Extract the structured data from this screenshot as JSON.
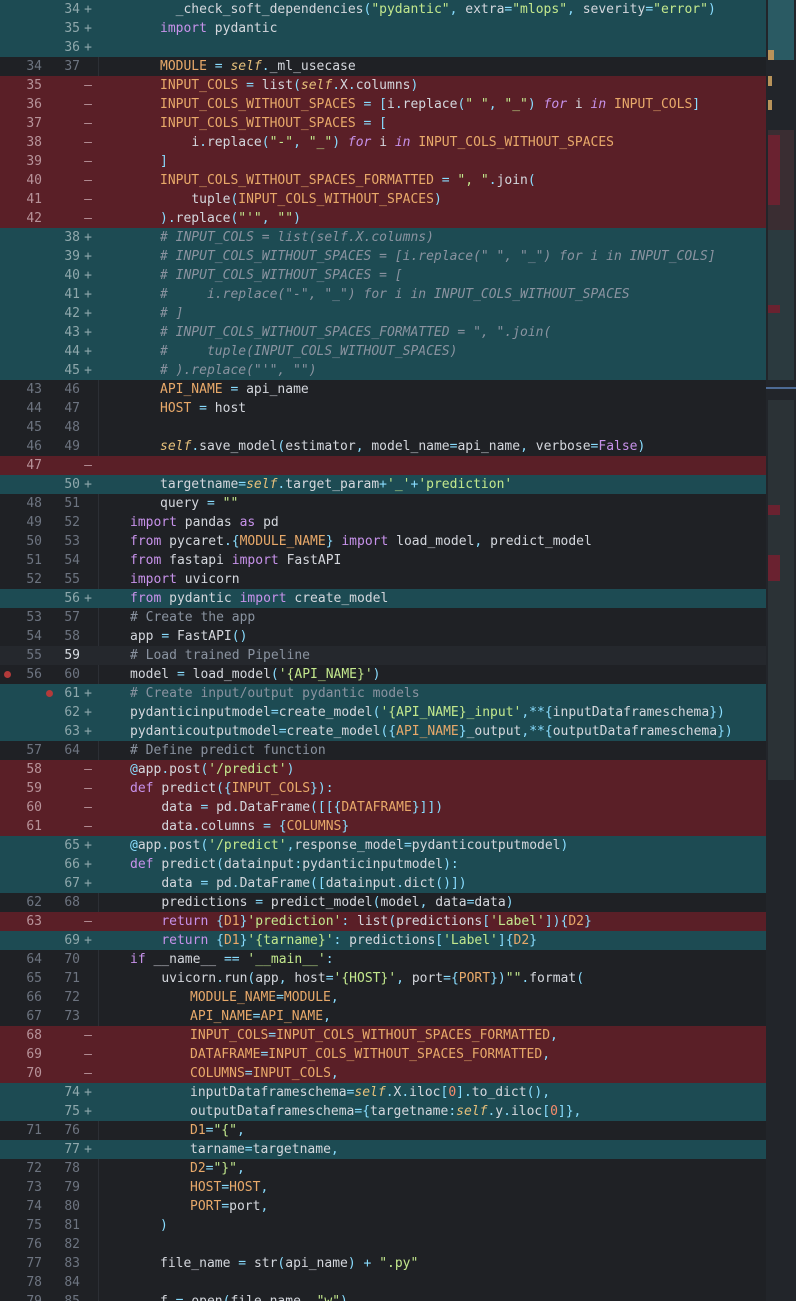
{
  "colors": {
    "added_bg": "#1d4b53",
    "removed_bg": "#5a1f27",
    "editor_bg": "#1f2125"
  },
  "lines": [
    {
      "old": "",
      "new": "34",
      "mark": "+",
      "type": "added",
      "code": "  _check_soft_dependencies(\"pydantic\", extra=\"mlops\", severity=\"error\")",
      "indent": 160
    },
    {
      "old": "",
      "new": "35",
      "mark": "+",
      "type": "added",
      "code": "import pydantic",
      "indent": 160
    },
    {
      "old": "",
      "new": "36",
      "mark": "+",
      "type": "added",
      "code": "",
      "indent": 160
    },
    {
      "old": "34",
      "new": "37",
      "mark": "",
      "type": "normal",
      "code": "MODULE = self._ml_usecase",
      "indent": 160
    },
    {
      "old": "35",
      "new": "",
      "mark": "—",
      "type": "removed",
      "code": "INPUT_COLS = list(self.X.columns)",
      "indent": 160
    },
    {
      "old": "36",
      "new": "",
      "mark": "—",
      "type": "removed",
      "code": "INPUT_COLS_WITHOUT_SPACES = [i.replace(\" \", \"_\") for i in INPUT_COLS]",
      "indent": 160
    },
    {
      "old": "37",
      "new": "",
      "mark": "—",
      "type": "removed",
      "code": "INPUT_COLS_WITHOUT_SPACES = [",
      "indent": 160
    },
    {
      "old": "38",
      "new": "",
      "mark": "—",
      "type": "removed",
      "code": "    i.replace(\"-\", \"_\") for i in INPUT_COLS_WITHOUT_SPACES",
      "indent": 160
    },
    {
      "old": "39",
      "new": "",
      "mark": "—",
      "type": "removed",
      "code": "]",
      "indent": 160
    },
    {
      "old": "40",
      "new": "",
      "mark": "—",
      "type": "removed",
      "code": "INPUT_COLS_WITHOUT_SPACES_FORMATTED = \", \".join(",
      "indent": 160
    },
    {
      "old": "41",
      "new": "",
      "mark": "—",
      "type": "removed",
      "code": "    tuple(INPUT_COLS_WITHOUT_SPACES)",
      "indent": 160
    },
    {
      "old": "42",
      "new": "",
      "mark": "—",
      "type": "removed",
      "code": ").replace(\"'\", \"\")",
      "indent": 160
    },
    {
      "old": "",
      "new": "38",
      "mark": "+",
      "type": "added",
      "code": "# INPUT_COLS = list(self.X.columns)",
      "indent": 160,
      "comment": true
    },
    {
      "old": "",
      "new": "39",
      "mark": "+",
      "type": "added",
      "code": "# INPUT_COLS_WITHOUT_SPACES = [i.replace(\" \", \"_\") for i in INPUT_COLS]",
      "indent": 160,
      "comment": true
    },
    {
      "old": "",
      "new": "40",
      "mark": "+",
      "type": "added",
      "code": "# INPUT_COLS_WITHOUT_SPACES = [",
      "indent": 160,
      "comment": true
    },
    {
      "old": "",
      "new": "41",
      "mark": "+",
      "type": "added",
      "code": "#     i.replace(\"-\", \"_\") for i in INPUT_COLS_WITHOUT_SPACES",
      "indent": 160,
      "comment": true
    },
    {
      "old": "",
      "new": "42",
      "mark": "+",
      "type": "added",
      "code": "# ]",
      "indent": 160,
      "comment": true
    },
    {
      "old": "",
      "new": "43",
      "mark": "+",
      "type": "added",
      "code": "# INPUT_COLS_WITHOUT_SPACES_FORMATTED = \", \".join(",
      "indent": 160,
      "comment": true
    },
    {
      "old": "",
      "new": "44",
      "mark": "+",
      "type": "added",
      "code": "#     tuple(INPUT_COLS_WITHOUT_SPACES)",
      "indent": 160,
      "comment": true
    },
    {
      "old": "",
      "new": "45",
      "mark": "+",
      "type": "added",
      "code": "# ).replace(\"'\", \"\")",
      "indent": 160,
      "comment": true
    },
    {
      "old": "43",
      "new": "46",
      "mark": "",
      "type": "normal",
      "code": "API_NAME = api_name",
      "indent": 160
    },
    {
      "old": "44",
      "new": "47",
      "mark": "",
      "type": "normal",
      "code": "HOST = host",
      "indent": 160
    },
    {
      "old": "45",
      "new": "48",
      "mark": "",
      "type": "normal",
      "code": "",
      "indent": 160
    },
    {
      "old": "46",
      "new": "49",
      "mark": "",
      "type": "normal",
      "code": "self.save_model(estimator, model_name=api_name, verbose=False)",
      "indent": 160
    },
    {
      "old": "47",
      "new": "",
      "mark": "—",
      "type": "removed",
      "code": "",
      "indent": 160
    },
    {
      "old": "",
      "new": "50",
      "mark": "+",
      "type": "added",
      "code": "targetname=self.target_param+'_'+'prediction'",
      "indent": 160
    },
    {
      "old": "48",
      "new": "51",
      "mark": "",
      "type": "normal",
      "code": "query = \"\"\"",
      "indent": 160
    },
    {
      "old": "49",
      "new": "52",
      "mark": "",
      "type": "normal",
      "code": "import pandas as pd",
      "indent": 130
    },
    {
      "old": "50",
      "new": "53",
      "mark": "",
      "type": "normal",
      "code": "from pycaret.{MODULE_NAME} import load_model, predict_model",
      "indent": 130
    },
    {
      "old": "51",
      "new": "54",
      "mark": "",
      "type": "normal",
      "code": "from fastapi import FastAPI",
      "indent": 130
    },
    {
      "old": "52",
      "new": "55",
      "mark": "",
      "type": "normal",
      "code": "import uvicorn",
      "indent": 130
    },
    {
      "old": "",
      "new": "56",
      "mark": "+",
      "type": "added",
      "code": "from pydantic import create_model",
      "indent": 130
    },
    {
      "old": "53",
      "new": "57",
      "mark": "",
      "type": "normal",
      "code": "# Create the app",
      "indent": 130
    },
    {
      "old": "54",
      "new": "58",
      "mark": "",
      "type": "normal",
      "code": "app = FastAPI()",
      "indent": 130
    },
    {
      "old": "55",
      "new": "59",
      "mark": "",
      "type": "hl",
      "code": "# Load trained Pipeline",
      "indent": 130,
      "active": true
    },
    {
      "old": "56",
      "new": "60",
      "mark": "",
      "type": "normal",
      "code": "model = load_model('{API_NAME}')",
      "indent": 130,
      "bp_old": true
    },
    {
      "old": "",
      "new": "61",
      "mark": "+",
      "type": "added",
      "code": "# Create input/output pydantic models",
      "indent": 130,
      "bp_new": true
    },
    {
      "old": "",
      "new": "62",
      "mark": "+",
      "type": "added",
      "code": "pydanticinputmodel=create_model('{API_NAME}_input',**{inputDataframeschema})",
      "indent": 130
    },
    {
      "old": "",
      "new": "63",
      "mark": "+",
      "type": "added",
      "code": "pydanticoutputmodel=create_model('{API_NAME}_output,**{outputDataframeschema})",
      "indent": 130
    },
    {
      "old": "57",
      "new": "64",
      "mark": "",
      "type": "normal",
      "code": "# Define predict function",
      "indent": 130
    },
    {
      "old": "58",
      "new": "",
      "mark": "—",
      "type": "removed",
      "code": "@app.post('/predict')",
      "indent": 130
    },
    {
      "old": "59",
      "new": "",
      "mark": "—",
      "type": "removed",
      "code": "def predict({INPUT_COLS}):",
      "indent": 130
    },
    {
      "old": "60",
      "new": "",
      "mark": "—",
      "type": "removed",
      "code": "    data = pd.DataFrame([[{DATAFRAME}]])",
      "indent": 130
    },
    {
      "old": "61",
      "new": "",
      "mark": "—",
      "type": "removed",
      "code": "    data.columns = {COLUMNS}",
      "indent": 130
    },
    {
      "old": "",
      "new": "65",
      "mark": "+",
      "type": "added",
      "code": "@app.post('/predict',response_model=pydanticoutputmodel)",
      "indent": 130
    },
    {
      "old": "",
      "new": "66",
      "mark": "+",
      "type": "added",
      "code": "def predict(datainput:pydanticinputmodel):",
      "indent": 130
    },
    {
      "old": "",
      "new": "67",
      "mark": "+",
      "type": "added",
      "code": "    data = pd.DataFrame([datainput.dict()])",
      "indent": 130
    },
    {
      "old": "62",
      "new": "68",
      "mark": "",
      "type": "normal",
      "code": "    predictions = predict_model(model, data=data)",
      "indent": 130
    },
    {
      "old": "63",
      "new": "",
      "mark": "—",
      "type": "removed",
      "code": "    return {D1}'prediction': list(predictions['Label']){D2}",
      "indent": 130
    },
    {
      "old": "",
      "new": "69",
      "mark": "+",
      "type": "added",
      "code": "    return {D1}'{tarname}': predictions['Label']{D2}",
      "indent": 130
    },
    {
      "old": "64",
      "new": "70",
      "mark": "",
      "type": "normal",
      "code": "if __name__ == '__main__':",
      "indent": 130
    },
    {
      "old": "65",
      "new": "71",
      "mark": "",
      "type": "normal",
      "code": "    uvicorn.run(app, host='{HOST}', port={PORT})\"\"\".format(",
      "indent": 130
    },
    {
      "old": "66",
      "new": "72",
      "mark": "",
      "type": "normal",
      "code": "MODULE_NAME=MODULE,",
      "indent": 190
    },
    {
      "old": "67",
      "new": "73",
      "mark": "",
      "type": "normal",
      "code": "API_NAME=API_NAME,",
      "indent": 190
    },
    {
      "old": "68",
      "new": "",
      "mark": "—",
      "type": "removed",
      "code": "INPUT_COLS=INPUT_COLS_WITHOUT_SPACES_FORMATTED,",
      "indent": 190
    },
    {
      "old": "69",
      "new": "",
      "mark": "—",
      "type": "removed",
      "code": "DATAFRAME=INPUT_COLS_WITHOUT_SPACES_FORMATTED,",
      "indent": 190
    },
    {
      "old": "70",
      "new": "",
      "mark": "—",
      "type": "removed",
      "code": "COLUMNS=INPUT_COLS,",
      "indent": 190
    },
    {
      "old": "",
      "new": "74",
      "mark": "+",
      "type": "added",
      "code": "inputDataframeschema=self.X.iloc[0].to_dict(),",
      "indent": 190
    },
    {
      "old": "",
      "new": "75",
      "mark": "+",
      "type": "added",
      "code": "outputDataframeschema={targetname:self.y.iloc[0]},",
      "indent": 190
    },
    {
      "old": "71",
      "new": "76",
      "mark": "",
      "type": "normal",
      "code": "D1=\"{\",",
      "indent": 190
    },
    {
      "old": "",
      "new": "77",
      "mark": "+",
      "type": "added",
      "code": "tarname=targetname,",
      "indent": 190
    },
    {
      "old": "72",
      "new": "78",
      "mark": "",
      "type": "normal",
      "code": "D2=\"}\",",
      "indent": 190
    },
    {
      "old": "73",
      "new": "79",
      "mark": "",
      "type": "normal",
      "code": "HOST=HOST,",
      "indent": 190
    },
    {
      "old": "74",
      "new": "80",
      "mark": "",
      "type": "normal",
      "code": "PORT=port,",
      "indent": 190
    },
    {
      "old": "75",
      "new": "81",
      "mark": "",
      "type": "normal",
      "code": ")",
      "indent": 160
    },
    {
      "old": "76",
      "new": "82",
      "mark": "",
      "type": "normal",
      "code": "",
      "indent": 160
    },
    {
      "old": "77",
      "new": "83",
      "mark": "",
      "type": "normal",
      "code": "file_name = str(api_name) + \".py\"",
      "indent": 160
    },
    {
      "old": "78",
      "new": "84",
      "mark": "",
      "type": "normal",
      "code": "",
      "indent": 160
    },
    {
      "old": "79",
      "new": "85",
      "mark": "",
      "type": "normal",
      "code": "f = open(file_name, \"w\")",
      "indent": 160
    }
  ]
}
